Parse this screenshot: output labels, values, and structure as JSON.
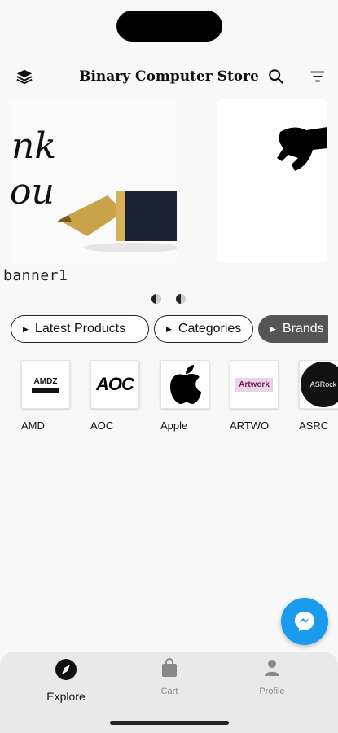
{
  "app": {
    "title": "Binary Computer Store"
  },
  "banners": [
    {
      "label": "banner1"
    },
    {
      "label": ""
    }
  ],
  "banner_art": {
    "script_line1": "nk",
    "script_line2": "ou"
  },
  "chips": [
    {
      "label": "Latest Products",
      "active": false
    },
    {
      "label": "Categories",
      "active": false
    },
    {
      "label": "Brands",
      "active": true
    }
  ],
  "brands": [
    {
      "name": "AMD",
      "logo_text": "AMDZ"
    },
    {
      "name": "AOC",
      "logo_text": "AOC"
    },
    {
      "name": "Apple",
      "logo_text": ""
    },
    {
      "name": "ARTWO",
      "logo_text": "Artwork"
    },
    {
      "name": "ASRC",
      "logo_text": "ASRock"
    }
  ],
  "bottom_nav": [
    {
      "label": "Explore",
      "active": true
    },
    {
      "label": "Cart",
      "active": false
    },
    {
      "label": "Profile",
      "active": false
    }
  ],
  "colors": {
    "accent": "#1a9bf0",
    "chip_active": "#555555",
    "nav_bg": "#e9e9e9"
  }
}
